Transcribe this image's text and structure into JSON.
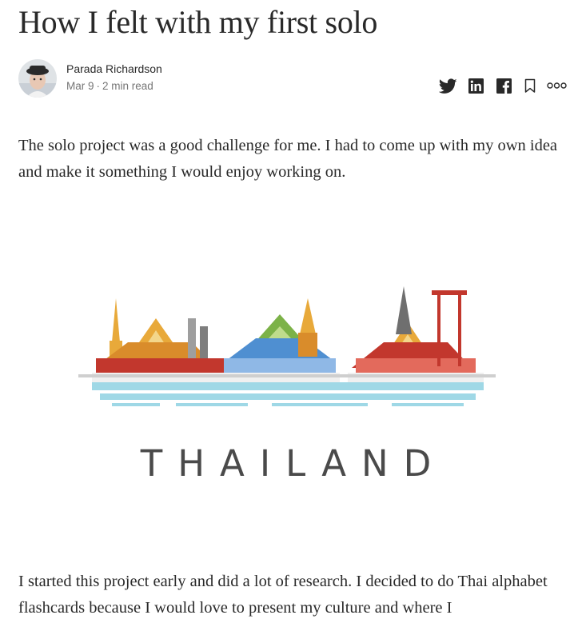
{
  "article": {
    "title": "How I felt with my first solo",
    "author": "Parada Richardson",
    "date": "Mar 9",
    "separator": "·",
    "read_time": "2 min read"
  },
  "actions": {
    "icons": [
      "twitter-icon",
      "linkedin-icon",
      "facebook-icon",
      "bookmark-icon",
      "more-icon"
    ]
  },
  "body": {
    "paragraph_1": "The solo project was a good challenge for me. I had to come up with my own idea and make it something I would enjoy working on.",
    "figure_text": "THAILAND",
    "paragraph_2": "I started this project early and did a lot of research. I decided to do Thai alphabet flashcards because I would love to present my culture and where I"
  },
  "colors": {
    "text": "#292929",
    "meta": "#757575",
    "gold": "#e8a93a",
    "red": "#c2372d",
    "blue": "#4f8fd1",
    "green": "#7cb248",
    "water": "#9fd8e6"
  }
}
